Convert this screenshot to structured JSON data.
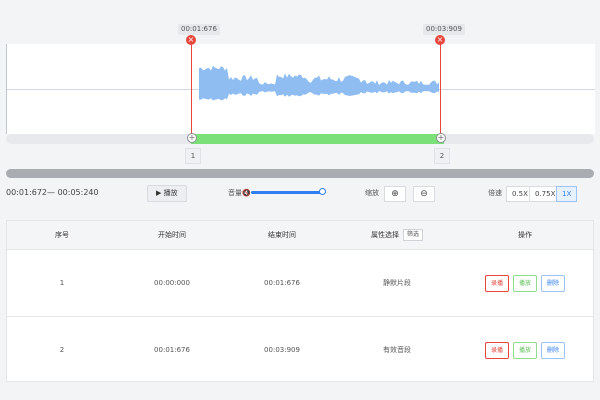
{
  "markers": {
    "start_time": "00:01:676",
    "end_time": "00:03:909",
    "close_glyph": "×",
    "handle_1": "1",
    "handle_2": "2"
  },
  "selection": {
    "start_fraction": 0.315,
    "end_fraction": 0.745
  },
  "controls": {
    "time_range": "00:01:672— 00:05:240",
    "play_label": "▶ 播放",
    "volume_label": "音量🔇",
    "volume_level": 1.0,
    "zoom_label": "缩放",
    "zoom_in": "⊕",
    "zoom_out": "⊖",
    "speed_label": "倍速",
    "speeds": [
      "0.5X",
      "0.75X",
      "1X"
    ],
    "active_speed": "1X"
  },
  "table": {
    "headers": {
      "index": "序号",
      "start": "开始时间",
      "end": "结束时间",
      "attr": "属性选择",
      "filter": "筛选",
      "actions": "操作"
    },
    "rows": [
      {
        "index": "1",
        "start": "00:00:000",
        "end": "00:01:676",
        "attr": "静默片段",
        "btn_record": "录播",
        "btn_play": "播放",
        "btn_delete": "删除"
      },
      {
        "index": "2",
        "start": "00:01:676",
        "end": "00:03:909",
        "attr": "有效音段",
        "btn_record": "录播",
        "btn_play": "播放",
        "btn_delete": "删除"
      }
    ]
  },
  "colors": {
    "marker": "#e8463c",
    "selection": "#7be078",
    "waveform": "#8fbdf2",
    "accent": "#2f7ff2"
  },
  "icons": [
    "close-icon",
    "play-icon",
    "volume-icon",
    "zoom-in-icon",
    "zoom-out-icon"
  ]
}
